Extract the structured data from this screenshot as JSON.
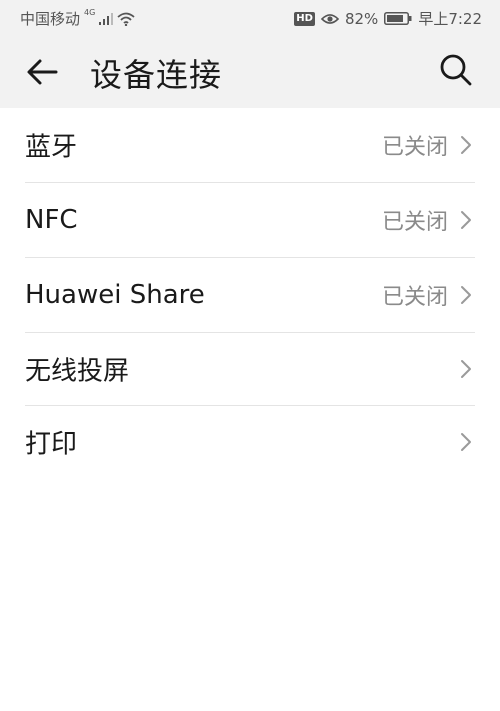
{
  "status_bar": {
    "carrier": "中国移动",
    "network": "4G",
    "hd": "HD",
    "battery": "82%",
    "time": "早上7:22"
  },
  "header": {
    "title": "设备连接"
  },
  "list": {
    "items": [
      {
        "label": "蓝牙",
        "value": "已关闭"
      },
      {
        "label": "NFC",
        "value": "已关闭"
      },
      {
        "label": "Huawei Share",
        "value": "已关闭"
      },
      {
        "label": "无线投屏",
        "value": ""
      },
      {
        "label": "打印",
        "value": ""
      }
    ]
  },
  "icons": {
    "back": "arrow-left-icon",
    "search": "search-icon",
    "chevron": "chevron-right-icon"
  },
  "colors": {
    "header_bg": "#f2f2f2",
    "value_text": "#8a8a8a",
    "divider": "#e4e4e4"
  }
}
